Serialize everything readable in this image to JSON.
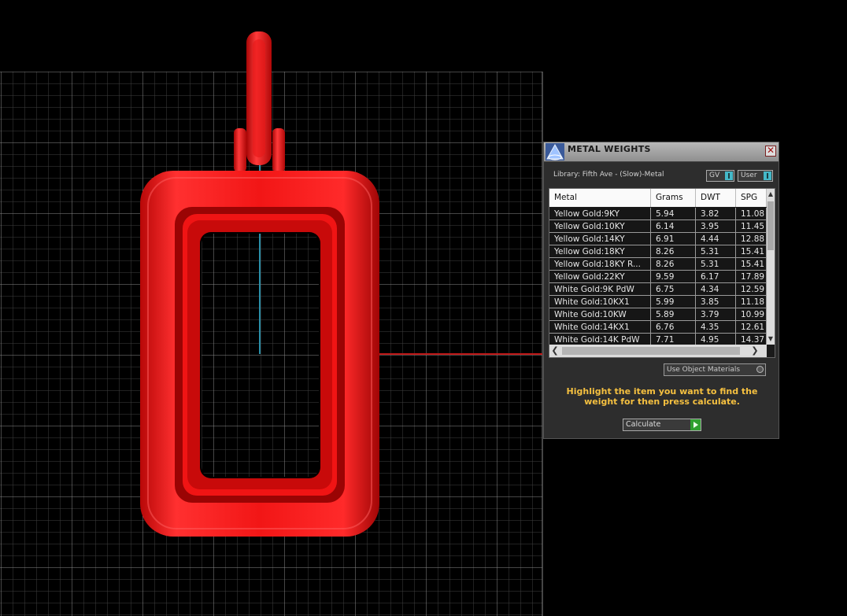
{
  "panel": {
    "title": "METAL WEIGHTS",
    "close_glyph": "✕",
    "library_label": "Library: Fifth Ave - (Slow)-Metal",
    "toggle_gv": "GV",
    "toggle_user": "User",
    "use_object_materials": "Use Object Materials",
    "hint": "Highlight the item you want to find the weight for then press calculate.",
    "calculate": "Calculate"
  },
  "table": {
    "columns": [
      "Metal",
      "Grams",
      "DWT",
      "SPG"
    ],
    "rows": [
      [
        "Yellow Gold:9KY",
        "5.94",
        "3.82",
        "11.08"
      ],
      [
        "Yellow Gold:10KY",
        "6.14",
        "3.95",
        "11.45"
      ],
      [
        "Yellow Gold:14KY",
        "6.91",
        "4.44",
        "12.88"
      ],
      [
        "Yellow Gold:18KY",
        "8.26",
        "5.31",
        "15.41"
      ],
      [
        "Yellow Gold:18KY R...",
        "8.26",
        "5.31",
        "15.41"
      ],
      [
        "Yellow Gold:22KY",
        "9.59",
        "6.17",
        "17.89"
      ],
      [
        "White Gold:9K PdW",
        "6.75",
        "4.34",
        "12.59"
      ],
      [
        "White Gold:10KX1",
        "5.99",
        "3.85",
        "11.18"
      ],
      [
        "White Gold:10KW",
        "5.89",
        "3.79",
        "10.99"
      ],
      [
        "White Gold:14KX1",
        "6.76",
        "4.35",
        "12.61"
      ],
      [
        "White Gold:14K PdW",
        "7.71",
        "4.95",
        "14.37"
      ]
    ]
  },
  "icons": {
    "app": "software-logo-icon",
    "close": "close-icon",
    "toggle": "toggle-switch-icon",
    "radio": "radio-icon",
    "play": "play-arrow-icon"
  },
  "colors": {
    "pendant": "#e01010",
    "grid": "#5a5a5a",
    "hint_text": "#f5c040",
    "axis_x": "#c01818",
    "axis_y": "#2a8fa8"
  }
}
